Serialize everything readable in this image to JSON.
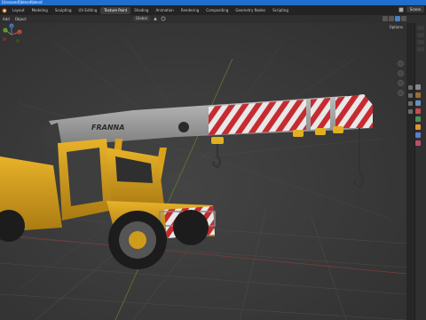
{
  "titlebar": {
    "text": "[Unsaved]\\blend\\blend"
  },
  "workspaces": {
    "tabs": [
      {
        "label": "Layout",
        "active": false
      },
      {
        "label": "Modeling",
        "active": false
      },
      {
        "label": "Sculpting",
        "active": false
      },
      {
        "label": "UV Editing",
        "active": false
      },
      {
        "label": "Texture Paint",
        "active": true
      },
      {
        "label": "Shading",
        "active": false
      },
      {
        "label": "Animation",
        "active": false
      },
      {
        "label": "Rendering",
        "active": false
      },
      {
        "label": "Compositing",
        "active": false
      },
      {
        "label": "Geometry Nodes",
        "active": false
      },
      {
        "label": "Scripting",
        "active": false
      }
    ],
    "scene_label": "Scene"
  },
  "header": {
    "menu_add": "Add",
    "menu_object": "Object",
    "transform_orientation": "Global",
    "options_label": "Options"
  },
  "gizmo_axes": {
    "x": "X",
    "y": "Y",
    "z": "Z"
  },
  "crane": {
    "brand_text": "FRANNA"
  },
  "colors": {
    "accent": "#1f6fd1",
    "crane_yellow": "#d9a21b",
    "stripe_red": "#c62b30",
    "stripe_white": "#e8e8e8",
    "viewport_bg": "#393939"
  }
}
